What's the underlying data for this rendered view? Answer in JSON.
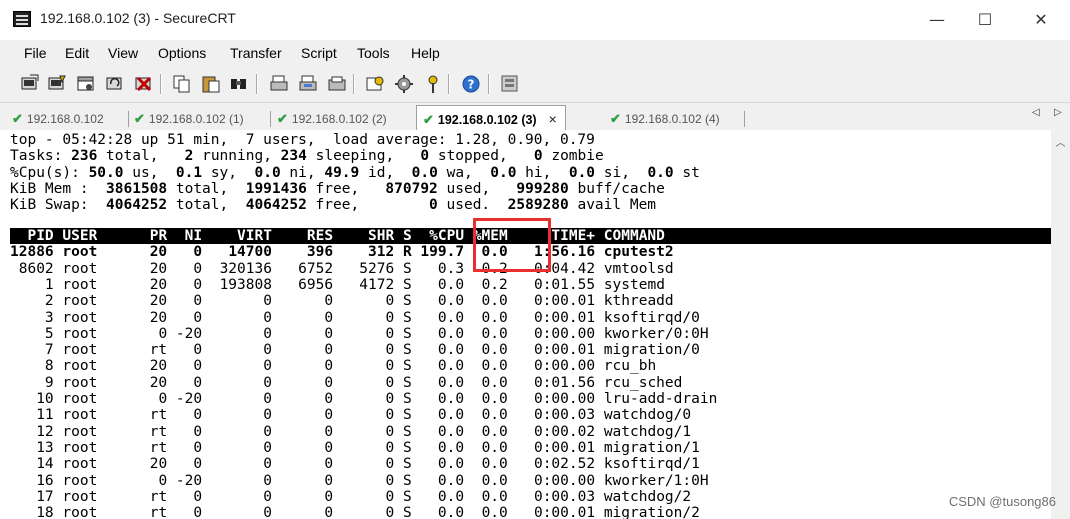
{
  "window": {
    "title": "192.168.0.102 (3) - SecureCRT",
    "minimize_glyph": "—",
    "maximize_glyph": "☐",
    "close_glyph": "✕"
  },
  "menu": [
    "File",
    "Edit",
    "View",
    "Options",
    "Transfer",
    "Script",
    "Tools",
    "Help"
  ],
  "toolbar": {
    "icons": [
      "connect-icon",
      "quick-connect-icon",
      "connect-in-tab-icon",
      "reconnect-icon",
      "disconnect-icon",
      "copy-icon",
      "paste-icon",
      "find-icon",
      "print-icon",
      "print-screen-icon",
      "print-setup-icon",
      "session-options-icon",
      "global-options-icon",
      "keymap-icon",
      "help-icon",
      "sftp-icon"
    ]
  },
  "tabs": [
    {
      "label": "192.168.0.102",
      "active": false
    },
    {
      "label": "192.168.0.102 (1)",
      "active": false
    },
    {
      "label": "192.168.0.102 (2)",
      "active": false
    },
    {
      "label": "192.168.0.102 (3)",
      "active": true
    },
    {
      "label": "192.168.0.102 (4)",
      "active": false
    }
  ],
  "tab_check_glyph": "✔",
  "tab_close_glyph": "×",
  "tab_nav": {
    "left": "◁",
    "right": "▷"
  },
  "scrollbar": {
    "up": "︿"
  },
  "terminal": {
    "summary": [
      [
        {
          "t": "top - 05:42:28 up 51 min,  7 users,  load average: 1.28, 0.90, 0.79"
        }
      ],
      [
        {
          "t": "Tasks: "
        },
        {
          "t": "236",
          "b": true
        },
        {
          "t": " total,   "
        },
        {
          "t": "2",
          "b": true
        },
        {
          "t": " running, "
        },
        {
          "t": "234",
          "b": true
        },
        {
          "t": " sleeping,   "
        },
        {
          "t": "0",
          "b": true
        },
        {
          "t": " stopped,   "
        },
        {
          "t": "0",
          "b": true
        },
        {
          "t": " zombie"
        }
      ],
      [
        {
          "t": "%Cpu(s): "
        },
        {
          "t": "50.0",
          "b": true
        },
        {
          "t": " us,  "
        },
        {
          "t": "0.1",
          "b": true
        },
        {
          "t": " sy,  "
        },
        {
          "t": "0.0",
          "b": true
        },
        {
          "t": " ni, "
        },
        {
          "t": "49.9",
          "b": true
        },
        {
          "t": " id,  "
        },
        {
          "t": "0.0",
          "b": true
        },
        {
          "t": " wa,  "
        },
        {
          "t": "0.0",
          "b": true
        },
        {
          "t": " hi,  "
        },
        {
          "t": "0.0",
          "b": true
        },
        {
          "t": " si,  "
        },
        {
          "t": "0.0",
          "b": true
        },
        {
          "t": " st"
        }
      ],
      [
        {
          "t": "KiB Mem :  "
        },
        {
          "t": "3861508",
          "b": true
        },
        {
          "t": " total,  "
        },
        {
          "t": "1991436",
          "b": true
        },
        {
          "t": " free,   "
        },
        {
          "t": "870792",
          "b": true
        },
        {
          "t": " used,   "
        },
        {
          "t": "999280",
          "b": true
        },
        {
          "t": " buff/cache"
        }
      ],
      [
        {
          "t": "KiB Swap:  "
        },
        {
          "t": "4064252",
          "b": true
        },
        {
          "t": " total,  "
        },
        {
          "t": "4064252",
          "b": true
        },
        {
          "t": " free,        "
        },
        {
          "t": "0",
          "b": true
        },
        {
          "t": " used.  "
        },
        {
          "t": "2589280",
          "b": true
        },
        {
          "t": " avail Mem"
        }
      ]
    ],
    "columns": [
      "PID",
      "USER",
      "PR",
      "NI",
      "VIRT",
      "RES",
      "SHR",
      "S",
      "%CPU",
      "%MEM",
      "TIME+",
      "COMMAND"
    ],
    "processes": [
      {
        "pid": "12886",
        "user": "root",
        "pr": "20",
        "ni": "0",
        "virt": "14700",
        "res": "396",
        "shr": "312",
        "s": "R",
        "cpu": "199.7",
        "mem": "0.0",
        "time": "1:56.16",
        "cmd": "cputest2",
        "bold": true
      },
      {
        "pid": "8602",
        "user": "root",
        "pr": "20",
        "ni": "0",
        "virt": "320136",
        "res": "6752",
        "shr": "5276",
        "s": "S",
        "cpu": "0.3",
        "mem": "0.2",
        "time": "0:04.42",
        "cmd": "vmtoolsd"
      },
      {
        "pid": "1",
        "user": "root",
        "pr": "20",
        "ni": "0",
        "virt": "193808",
        "res": "6956",
        "shr": "4172",
        "s": "S",
        "cpu": "0.0",
        "mem": "0.2",
        "time": "0:01.55",
        "cmd": "systemd"
      },
      {
        "pid": "2",
        "user": "root",
        "pr": "20",
        "ni": "0",
        "virt": "0",
        "res": "0",
        "shr": "0",
        "s": "S",
        "cpu": "0.0",
        "mem": "0.0",
        "time": "0:00.01",
        "cmd": "kthreadd"
      },
      {
        "pid": "3",
        "user": "root",
        "pr": "20",
        "ni": "0",
        "virt": "0",
        "res": "0",
        "shr": "0",
        "s": "S",
        "cpu": "0.0",
        "mem": "0.0",
        "time": "0:00.01",
        "cmd": "ksoftirqd/0"
      },
      {
        "pid": "5",
        "user": "root",
        "pr": "0",
        "ni": "-20",
        "virt": "0",
        "res": "0",
        "shr": "0",
        "s": "S",
        "cpu": "0.0",
        "mem": "0.0",
        "time": "0:00.00",
        "cmd": "kworker/0:0H"
      },
      {
        "pid": "7",
        "user": "root",
        "pr": "rt",
        "ni": "0",
        "virt": "0",
        "res": "0",
        "shr": "0",
        "s": "S",
        "cpu": "0.0",
        "mem": "0.0",
        "time": "0:00.01",
        "cmd": "migration/0"
      },
      {
        "pid": "8",
        "user": "root",
        "pr": "20",
        "ni": "0",
        "virt": "0",
        "res": "0",
        "shr": "0",
        "s": "S",
        "cpu": "0.0",
        "mem": "0.0",
        "time": "0:00.00",
        "cmd": "rcu_bh"
      },
      {
        "pid": "9",
        "user": "root",
        "pr": "20",
        "ni": "0",
        "virt": "0",
        "res": "0",
        "shr": "0",
        "s": "S",
        "cpu": "0.0",
        "mem": "0.0",
        "time": "0:01.56",
        "cmd": "rcu_sched"
      },
      {
        "pid": "10",
        "user": "root",
        "pr": "0",
        "ni": "-20",
        "virt": "0",
        "res": "0",
        "shr": "0",
        "s": "S",
        "cpu": "0.0",
        "mem": "0.0",
        "time": "0:00.00",
        "cmd": "lru-add-drain"
      },
      {
        "pid": "11",
        "user": "root",
        "pr": "rt",
        "ni": "0",
        "virt": "0",
        "res": "0",
        "shr": "0",
        "s": "S",
        "cpu": "0.0",
        "mem": "0.0",
        "time": "0:00.03",
        "cmd": "watchdog/0"
      },
      {
        "pid": "12",
        "user": "root",
        "pr": "rt",
        "ni": "0",
        "virt": "0",
        "res": "0",
        "shr": "0",
        "s": "S",
        "cpu": "0.0",
        "mem": "0.0",
        "time": "0:00.02",
        "cmd": "watchdog/1"
      },
      {
        "pid": "13",
        "user": "root",
        "pr": "rt",
        "ni": "0",
        "virt": "0",
        "res": "0",
        "shr": "0",
        "s": "S",
        "cpu": "0.0",
        "mem": "0.0",
        "time": "0:00.01",
        "cmd": "migration/1"
      },
      {
        "pid": "14",
        "user": "root",
        "pr": "20",
        "ni": "0",
        "virt": "0",
        "res": "0",
        "shr": "0",
        "s": "S",
        "cpu": "0.0",
        "mem": "0.0",
        "time": "0:02.52",
        "cmd": "ksoftirqd/1"
      },
      {
        "pid": "16",
        "user": "root",
        "pr": "0",
        "ni": "-20",
        "virt": "0",
        "res": "0",
        "shr": "0",
        "s": "S",
        "cpu": "0.0",
        "mem": "0.0",
        "time": "0:00.00",
        "cmd": "kworker/1:0H"
      },
      {
        "pid": "17",
        "user": "root",
        "pr": "rt",
        "ni": "0",
        "virt": "0",
        "res": "0",
        "shr": "0",
        "s": "S",
        "cpu": "0.0",
        "mem": "0.0",
        "time": "0:00.03",
        "cmd": "watchdog/2"
      },
      {
        "pid": "18",
        "user": "root",
        "pr": "rt",
        "ni": "0",
        "virt": "0",
        "res": "0",
        "shr": "0",
        "s": "S",
        "cpu": "0.0",
        "mem": "0.0",
        "time": "0:00.01",
        "cmd": "migration/2"
      }
    ]
  },
  "annotation": {
    "color": "#e8302f"
  },
  "watermark": "CSDN @tusong86",
  "colors": {
    "check": "#2ea043",
    "chrome": "#f0f0f0",
    "header_bg": "#000000"
  }
}
